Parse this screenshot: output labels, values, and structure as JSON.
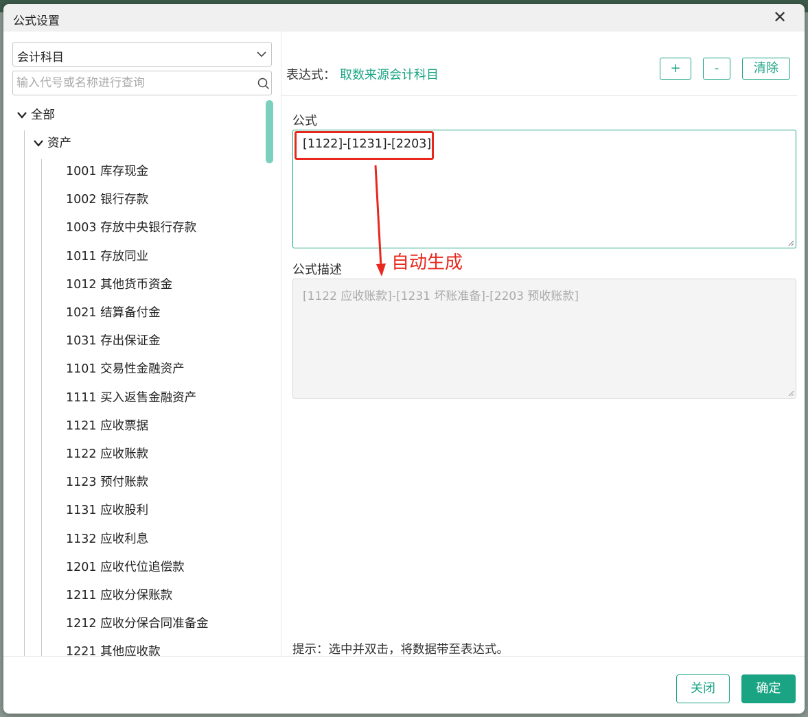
{
  "dialog": {
    "title": "公式设置",
    "close_icon": "close-icon"
  },
  "left": {
    "category_select": "会计科目",
    "search_placeholder": "输入代号或名称进行查询",
    "tree": {
      "root": "全部",
      "group": "资产",
      "items": [
        "1001 库存现金",
        "1002 银行存款",
        "1003 存放中央银行存款",
        "1011 存放同业",
        "1012 其他货币资金",
        "1021 结算备付金",
        "1031 存出保证金",
        "1101 交易性金融资产",
        "1111 买入返售金融资产",
        "1121 应收票据",
        "1122 应收账款",
        "1123 预付账款",
        "1131 应收股利",
        "1132 应收利息",
        "1201 应收代位追偿款",
        "1211 应收分保账款",
        "1212 应收分保合同准备金",
        "1221 其他应收款"
      ]
    }
  },
  "right": {
    "expression_label": "表达式：",
    "expression_value": "取数来源会计科目",
    "buttons": {
      "add": "+",
      "subtract": "-",
      "clear": "清除"
    },
    "formula_label": "公式",
    "formula_value": "[1122]-[1231]-[2203]",
    "description_label": "公式描述",
    "description_value": "[1122 应收账款]-[1231 坏账准备]-[2203 预收账款]",
    "annotation": "自动生成",
    "hint": "提示：选中并双击，将数据带至表达式。"
  },
  "footer": {
    "close": "关闭",
    "confirm": "确定"
  },
  "colors": {
    "accent": "#1aa484",
    "annotation": "#e8281e",
    "scrollbar": "#7dd0be"
  }
}
